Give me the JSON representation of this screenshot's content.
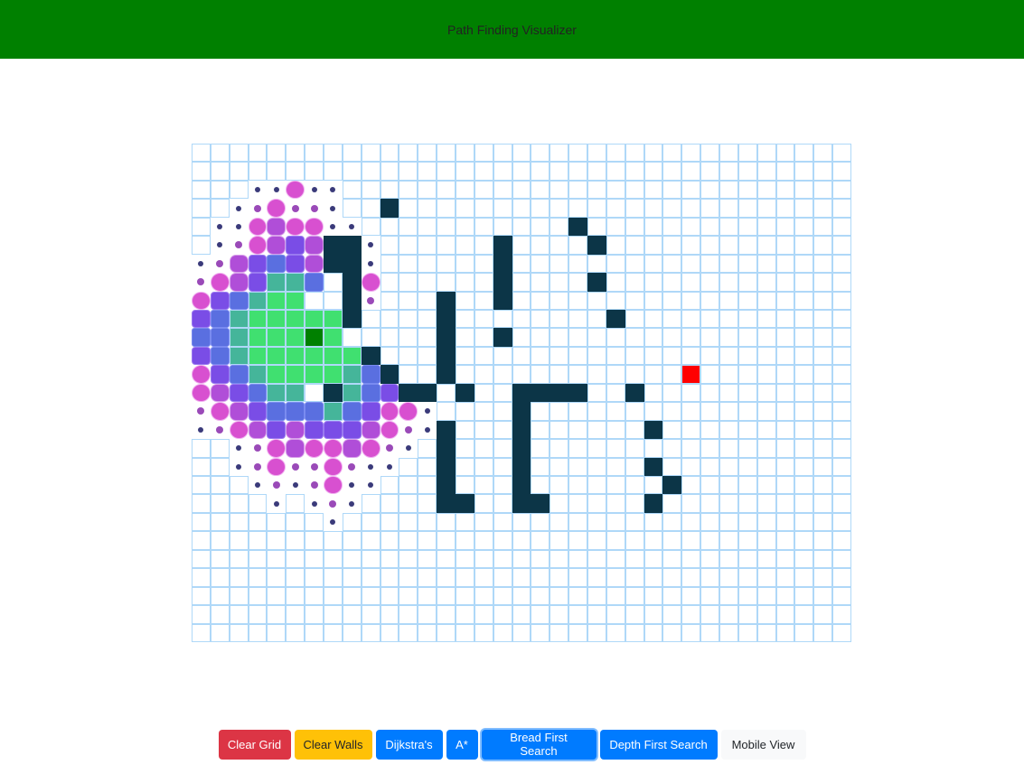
{
  "navbar": {
    "title": "Path Finding Visualizer"
  },
  "grid": {
    "rows": 27,
    "cols": 35,
    "start": [
      10,
      6
    ],
    "target": [
      12,
      26
    ],
    "walls": [
      [
        3,
        10
      ],
      [
        4,
        20
      ],
      [
        5,
        7
      ],
      [
        5,
        8
      ],
      [
        5,
        16
      ],
      [
        5,
        21
      ],
      [
        6,
        7
      ],
      [
        6,
        8
      ],
      [
        6,
        16
      ],
      [
        7,
        8
      ],
      [
        7,
        16
      ],
      [
        7,
        21
      ],
      [
        8,
        8
      ],
      [
        8,
        13
      ],
      [
        8,
        16
      ],
      [
        9,
        8
      ],
      [
        9,
        13
      ],
      [
        9,
        22
      ],
      [
        10,
        13
      ],
      [
        10,
        16
      ],
      [
        11,
        9
      ],
      [
        11,
        13
      ],
      [
        12,
        10
      ],
      [
        12,
        13
      ],
      [
        13,
        7
      ],
      [
        13,
        11
      ],
      [
        13,
        12
      ],
      [
        13,
        14
      ],
      [
        13,
        17
      ],
      [
        13,
        18
      ],
      [
        13,
        19
      ],
      [
        13,
        20
      ],
      [
        13,
        23
      ],
      [
        14,
        17
      ],
      [
        15,
        13
      ],
      [
        15,
        17
      ],
      [
        15,
        24
      ],
      [
        16,
        13
      ],
      [
        16,
        17
      ],
      [
        17,
        13
      ],
      [
        17,
        17
      ],
      [
        17,
        24
      ],
      [
        18,
        13
      ],
      [
        18,
        17
      ],
      [
        18,
        25
      ],
      [
        19,
        13
      ],
      [
        19,
        14
      ],
      [
        19,
        17
      ],
      [
        19,
        18
      ],
      [
        19,
        24
      ]
    ],
    "visited_levels": [
      [
        "v8",
        2,
        3
      ],
      [
        "v8",
        2,
        4
      ],
      [
        "v6",
        2,
        5
      ],
      [
        "v8",
        2,
        6
      ],
      [
        "v8",
        2,
        7
      ],
      [
        "v8",
        3,
        2
      ],
      [
        "v7",
        3,
        3
      ],
      [
        "v6",
        3,
        4
      ],
      [
        "v7",
        3,
        5
      ],
      [
        "v7",
        3,
        6
      ],
      [
        "v8",
        3,
        7
      ],
      [
        "v8",
        4,
        1
      ],
      [
        "v8",
        4,
        2
      ],
      [
        "v6",
        4,
        3
      ],
      [
        "v5",
        4,
        4
      ],
      [
        "v6",
        4,
        5
      ],
      [
        "v6",
        4,
        6
      ],
      [
        "v8",
        4,
        7
      ],
      [
        "v8",
        4,
        8
      ],
      [
        "v8",
        5,
        1
      ],
      [
        "v7",
        5,
        2
      ],
      [
        "v6",
        5,
        3
      ],
      [
        "v5",
        5,
        4
      ],
      [
        "v4",
        5,
        5
      ],
      [
        "v5",
        5,
        6
      ],
      [
        "v6",
        5,
        7
      ],
      [
        "v7",
        5,
        8
      ],
      [
        "v8",
        5,
        9
      ],
      [
        "v8",
        6,
        0
      ],
      [
        "v7",
        6,
        1
      ],
      [
        "v5",
        6,
        2
      ],
      [
        "v4",
        6,
        3
      ],
      [
        "v3",
        6,
        4
      ],
      [
        "v4",
        6,
        5
      ],
      [
        "v5",
        6,
        6
      ],
      [
        "v6",
        6,
        7
      ],
      [
        "v7",
        6,
        8
      ],
      [
        "v8",
        6,
        9
      ],
      [
        "v7",
        7,
        0
      ],
      [
        "v6",
        7,
        1
      ],
      [
        "v5",
        7,
        2
      ],
      [
        "v4",
        7,
        3
      ],
      [
        "v2",
        7,
        4
      ],
      [
        "v2",
        7,
        5
      ],
      [
        "v3",
        7,
        6
      ],
      [
        "v6",
        7,
        9
      ],
      [
        "v6",
        8,
        0
      ],
      [
        "v4",
        8,
        1
      ],
      [
        "v3",
        8,
        2
      ],
      [
        "v2",
        8,
        3
      ],
      [
        "v1",
        8,
        4
      ],
      [
        "v1",
        8,
        5
      ],
      [
        "v7",
        8,
        9
      ],
      [
        "v4",
        9,
        0
      ],
      [
        "v3",
        9,
        1
      ],
      [
        "v2",
        9,
        2
      ],
      [
        "v1",
        9,
        3
      ],
      [
        "v1",
        9,
        4
      ],
      [
        "v1",
        9,
        5
      ],
      [
        "v1",
        9,
        6
      ],
      [
        "v1",
        9,
        7
      ],
      [
        "v3",
        10,
        0
      ],
      [
        "v3",
        10,
        1
      ],
      [
        "v2",
        10,
        2
      ],
      [
        "v1",
        10,
        3
      ],
      [
        "v1",
        10,
        4
      ],
      [
        "v1",
        10,
        5
      ],
      [
        "v1",
        10,
        7
      ],
      [
        "v4",
        11,
        0
      ],
      [
        "v3",
        11,
        1
      ],
      [
        "v2",
        11,
        2
      ],
      [
        "v1",
        11,
        3
      ],
      [
        "v1",
        11,
        4
      ],
      [
        "v1",
        11,
        5
      ],
      [
        "v1",
        11,
        6
      ],
      [
        "v1",
        11,
        7
      ],
      [
        "v1",
        11,
        8
      ],
      [
        "v6",
        12,
        0
      ],
      [
        "v4",
        12,
        1
      ],
      [
        "v3",
        12,
        2
      ],
      [
        "v2",
        12,
        3
      ],
      [
        "v1",
        12,
        4
      ],
      [
        "v1",
        12,
        5
      ],
      [
        "v1",
        12,
        6
      ],
      [
        "v1",
        12,
        7
      ],
      [
        "v2",
        12,
        8
      ],
      [
        "v3",
        12,
        9
      ],
      [
        "v6",
        13,
        0
      ],
      [
        "v5",
        13,
        1
      ],
      [
        "v4",
        13,
        2
      ],
      [
        "v3",
        13,
        3
      ],
      [
        "v2",
        13,
        4
      ],
      [
        "v2",
        13,
        5
      ],
      [
        "v2",
        13,
        8
      ],
      [
        "v3",
        13,
        9
      ],
      [
        "v4",
        13,
        10
      ],
      [
        "v7",
        14,
        0
      ],
      [
        "v6",
        14,
        1
      ],
      [
        "v5",
        14,
        2
      ],
      [
        "v4",
        14,
        3
      ],
      [
        "v3",
        14,
        4
      ],
      [
        "v3",
        14,
        5
      ],
      [
        "v3",
        14,
        6
      ],
      [
        "v2",
        14,
        7
      ],
      [
        "v3",
        14,
        8
      ],
      [
        "v4",
        14,
        9
      ],
      [
        "v6",
        14,
        10
      ],
      [
        "v6",
        14,
        11
      ],
      [
        "v8",
        14,
        12
      ],
      [
        "v8",
        15,
        0
      ],
      [
        "v7",
        15,
        1
      ],
      [
        "v6",
        15,
        2
      ],
      [
        "v5",
        15,
        3
      ],
      [
        "v4",
        15,
        4
      ],
      [
        "v5",
        15,
        5
      ],
      [
        "v4",
        15,
        6
      ],
      [
        "v4",
        15,
        7
      ],
      [
        "v4",
        15,
        8
      ],
      [
        "v5",
        15,
        9
      ],
      [
        "v6",
        15,
        10
      ],
      [
        "v7",
        15,
        11
      ],
      [
        "v8",
        15,
        12
      ],
      [
        "v8",
        16,
        2
      ],
      [
        "v7",
        16,
        3
      ],
      [
        "v6",
        16,
        4
      ],
      [
        "v5",
        16,
        5
      ],
      [
        "v6",
        16,
        6
      ],
      [
        "v6",
        16,
        7
      ],
      [
        "v5",
        16,
        8
      ],
      [
        "v6",
        16,
        9
      ],
      [
        "v7",
        16,
        10
      ],
      [
        "v8",
        16,
        11
      ],
      [
        "v8",
        17,
        2
      ],
      [
        "v7",
        17,
        3
      ],
      [
        "v6",
        17,
        4
      ],
      [
        "v7",
        17,
        5
      ],
      [
        "v7",
        17,
        6
      ],
      [
        "v6",
        17,
        7
      ],
      [
        "v7",
        17,
        8
      ],
      [
        "v8",
        17,
        9
      ],
      [
        "v8",
        17,
        10
      ],
      [
        "v8",
        18,
        3
      ],
      [
        "v7",
        18,
        4
      ],
      [
        "v8",
        18,
        5
      ],
      [
        "v7",
        18,
        6
      ],
      [
        "v6",
        18,
        7
      ],
      [
        "v8",
        18,
        8
      ],
      [
        "v8",
        18,
        9
      ],
      [
        "v8",
        19,
        4
      ],
      [
        "v8",
        19,
        6
      ],
      [
        "v7",
        19,
        7
      ],
      [
        "v8",
        19,
        8
      ],
      [
        "v8",
        20,
        7
      ]
    ]
  },
  "toolbar": {
    "clear_grid": "Clear Grid",
    "clear_walls": "Clear Walls",
    "dijkstra": "Dijkstra's",
    "astar": "A*",
    "bfs": "Bread First Search",
    "dfs": "Depth First Search",
    "mobile_view": "Mobile View"
  },
  "colors": {
    "navbar": "#008000",
    "wall": "#0c3547",
    "start": "#008000",
    "target": "#ff0000",
    "grid_line": "#afd8f8"
  }
}
